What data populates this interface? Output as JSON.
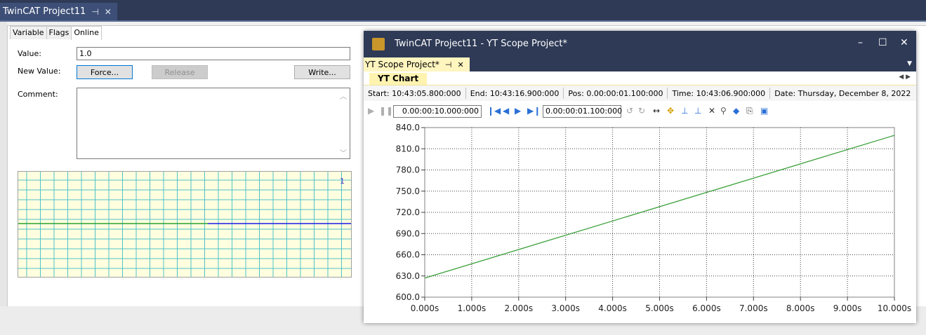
{
  "doc_tab": {
    "title": "TwinCAT Project11",
    "pin": "⊣",
    "close": "✕"
  },
  "online_panel": {
    "tabs": [
      {
        "label": "Variable"
      },
      {
        "label": "Flags"
      },
      {
        "label": "Online",
        "active": true
      }
    ],
    "value_label": "Value:",
    "value": "1.0",
    "new_value_label": "New Value:",
    "force_label": "Force...",
    "release_label": "Release",
    "write_label": "Write...",
    "comment_label": "Comment:",
    "comment_value": "",
    "mini_chart_marker": "1",
    "colors": {
      "grid": "#4fc1c7",
      "bg": "#ffffe0",
      "line_left": "#2ca02c",
      "line_right": "#1a1ae6"
    }
  },
  "scope_window": {
    "title": "TwinCAT Project11 - YT Scope Project*",
    "tab_label": "YT Scope Project*",
    "tab_pin": "⊣",
    "tab_close": "✕",
    "chart_tab": "YT Chart",
    "info": {
      "start_label": "Start:",
      "start": "10:43:05.800:000",
      "end_label": "End:",
      "end": "10:43:16.900:000",
      "pos_label": "Pos:",
      "pos": "0.00:00:01.100:000",
      "time_label": "Time:",
      "time": "10:43:06.900:000",
      "date_label": "Date:",
      "date": "Thursday, December 8, 2022"
    },
    "toolbar": {
      "span_value": "0.00:00:10.000:000",
      "pos_value": "0.00:00:01.100:000"
    }
  },
  "chart_data": {
    "type": "line",
    "x_ticks": [
      "0.000s",
      "1.000s",
      "2.000s",
      "3.000s",
      "4.000s",
      "5.000s",
      "6.000s",
      "7.000s",
      "8.000s",
      "9.000s",
      "10.000s"
    ],
    "y_ticks": [
      "600.0",
      "630.0",
      "660.0",
      "690.0",
      "720.0",
      "750.0",
      "780.0",
      "810.0",
      "840.0"
    ],
    "xlim": [
      0,
      10
    ],
    "ylim": [
      600,
      840
    ],
    "grid": true,
    "series": [
      {
        "color": "#3aa03a",
        "x": [
          0,
          10
        ],
        "y": [
          627,
          829
        ]
      }
    ]
  }
}
